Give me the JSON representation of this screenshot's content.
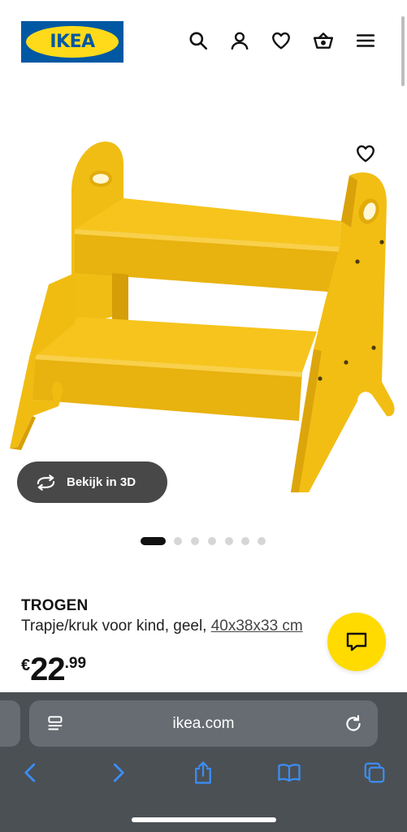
{
  "header": {
    "logo_text": "IKEA",
    "icons": [
      "search-icon",
      "account-icon",
      "heart-icon",
      "basket-icon",
      "menu-icon"
    ]
  },
  "product": {
    "view_3d_label": "Bekijk in 3D",
    "name": "TROGEN",
    "description": "Trapje/kruk voor kind, geel, ",
    "dimensions": "40x38x33 cm",
    "price_currency": "€",
    "price_integer": "22",
    "price_decimal": ".99",
    "image_count": 7,
    "active_image": 1,
    "colors": {
      "stool": "#f5c518",
      "accent": "#0058a3",
      "chat": "#ffdb00"
    }
  },
  "browser": {
    "url": "ikea.com"
  }
}
